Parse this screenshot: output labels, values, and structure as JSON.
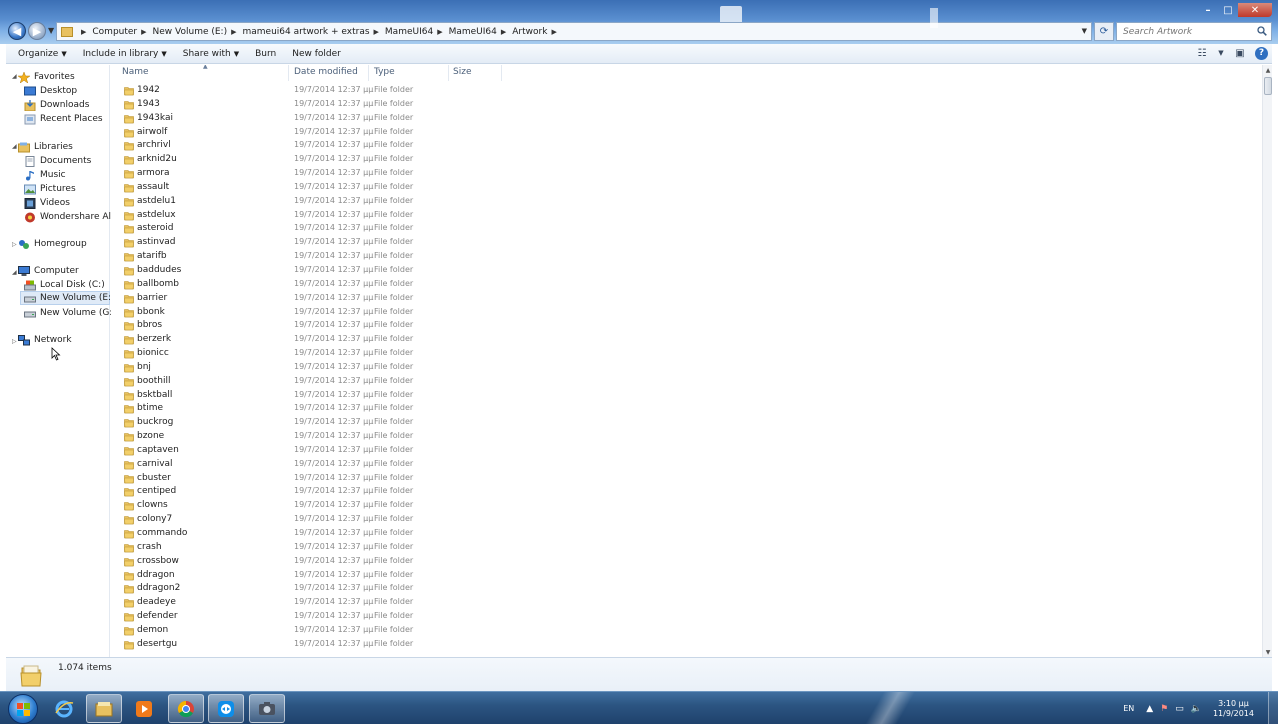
{
  "window": {
    "controls": {
      "minimize": "–",
      "maximize": "□",
      "close": "✕"
    }
  },
  "address": {
    "crumbs": [
      "Computer",
      "New Volume (E:)",
      "mameui64 artwork + extras",
      "MameUI64",
      "MameUI64",
      "Artwork"
    ],
    "search_placeholder": "Search Artwork"
  },
  "toolbar": {
    "organize": "Organize",
    "include_in_library": "Include in library",
    "share_with": "Share with",
    "burn": "Burn",
    "new_folder": "New folder"
  },
  "nav": {
    "favorites": "Favorites",
    "desktop": "Desktop",
    "downloads": "Downloads",
    "recent_places": "Recent Places",
    "libraries": "Libraries",
    "documents": "Documents",
    "music": "Music",
    "pictures": "Pictures",
    "videos": "Videos",
    "wondershare": "Wondershare AllMy",
    "homegroup": "Homegroup",
    "computer": "Computer",
    "local_disk": "Local Disk (C:)",
    "new_volume_e": "New Volume (E:)",
    "new_volume_g": "New Volume (G:)",
    "network": "Network"
  },
  "columns": {
    "name": "Name",
    "date": "Date modified",
    "type": "Type",
    "size": "Size"
  },
  "files": [
    {
      "name": "1942",
      "date": "19/7/2014 12:37 μμ",
      "type": "File folder"
    },
    {
      "name": "1943",
      "date": "19/7/2014 12:37 μμ",
      "type": "File folder"
    },
    {
      "name": "1943kai",
      "date": "19/7/2014 12:37 μμ",
      "type": "File folder"
    },
    {
      "name": "airwolf",
      "date": "19/7/2014 12:37 μμ",
      "type": "File folder"
    },
    {
      "name": "archrivl",
      "date": "19/7/2014 12:37 μμ",
      "type": "File folder"
    },
    {
      "name": "arknid2u",
      "date": "19/7/2014 12:37 μμ",
      "type": "File folder"
    },
    {
      "name": "armora",
      "date": "19/7/2014 12:37 μμ",
      "type": "File folder"
    },
    {
      "name": "assault",
      "date": "19/7/2014 12:37 μμ",
      "type": "File folder"
    },
    {
      "name": "astdelu1",
      "date": "19/7/2014 12:37 μμ",
      "type": "File folder"
    },
    {
      "name": "astdelux",
      "date": "19/7/2014 12:37 μμ",
      "type": "File folder"
    },
    {
      "name": "asteroid",
      "date": "19/7/2014 12:37 μμ",
      "type": "File folder"
    },
    {
      "name": "astinvad",
      "date": "19/7/2014 12:37 μμ",
      "type": "File folder"
    },
    {
      "name": "atarifb",
      "date": "19/7/2014 12:37 μμ",
      "type": "File folder"
    },
    {
      "name": "baddudes",
      "date": "19/7/2014 12:37 μμ",
      "type": "File folder"
    },
    {
      "name": "ballbomb",
      "date": "19/7/2014 12:37 μμ",
      "type": "File folder"
    },
    {
      "name": "barrier",
      "date": "19/7/2014 12:37 μμ",
      "type": "File folder"
    },
    {
      "name": "bbonk",
      "date": "19/7/2014 12:37 μμ",
      "type": "File folder"
    },
    {
      "name": "bbros",
      "date": "19/7/2014 12:37 μμ",
      "type": "File folder"
    },
    {
      "name": "berzerk",
      "date": "19/7/2014 12:37 μμ",
      "type": "File folder"
    },
    {
      "name": "bionicc",
      "date": "19/7/2014 12:37 μμ",
      "type": "File folder"
    },
    {
      "name": "bnj",
      "date": "19/7/2014 12:37 μμ",
      "type": "File folder"
    },
    {
      "name": "boothill",
      "date": "19/7/2014 12:37 μμ",
      "type": "File folder"
    },
    {
      "name": "bsktball",
      "date": "19/7/2014 12:37 μμ",
      "type": "File folder"
    },
    {
      "name": "btime",
      "date": "19/7/2014 12:37 μμ",
      "type": "File folder"
    },
    {
      "name": "buckrog",
      "date": "19/7/2014 12:37 μμ",
      "type": "File folder"
    },
    {
      "name": "bzone",
      "date": "19/7/2014 12:37 μμ",
      "type": "File folder"
    },
    {
      "name": "captaven",
      "date": "19/7/2014 12:37 μμ",
      "type": "File folder"
    },
    {
      "name": "carnival",
      "date": "19/7/2014 12:37 μμ",
      "type": "File folder"
    },
    {
      "name": "cbuster",
      "date": "19/7/2014 12:37 μμ",
      "type": "File folder"
    },
    {
      "name": "centiped",
      "date": "19/7/2014 12:37 μμ",
      "type": "File folder"
    },
    {
      "name": "clowns",
      "date": "19/7/2014 12:37 μμ",
      "type": "File folder"
    },
    {
      "name": "colony7",
      "date": "19/7/2014 12:37 μμ",
      "type": "File folder"
    },
    {
      "name": "commando",
      "date": "19/7/2014 12:37 μμ",
      "type": "File folder"
    },
    {
      "name": "crash",
      "date": "19/7/2014 12:37 μμ",
      "type": "File folder"
    },
    {
      "name": "crossbow",
      "date": "19/7/2014 12:37 μμ",
      "type": "File folder"
    },
    {
      "name": "ddragon",
      "date": "19/7/2014 12:37 μμ",
      "type": "File folder"
    },
    {
      "name": "ddragon2",
      "date": "19/7/2014 12:37 μμ",
      "type": "File folder"
    },
    {
      "name": "deadeye",
      "date": "19/7/2014 12:37 μμ",
      "type": "File folder"
    },
    {
      "name": "defender",
      "date": "19/7/2014 12:37 μμ",
      "type": "File folder"
    },
    {
      "name": "demon",
      "date": "19/7/2014 12:37 μμ",
      "type": "File folder"
    },
    {
      "name": "desertgu",
      "date": "19/7/2014 12:37 μμ",
      "type": "File folder"
    }
  ],
  "details": {
    "item_count": "1.074 items"
  },
  "taskbar": {
    "lang": "EN",
    "time": "3:10 μμ",
    "date": "11/9/2014"
  }
}
